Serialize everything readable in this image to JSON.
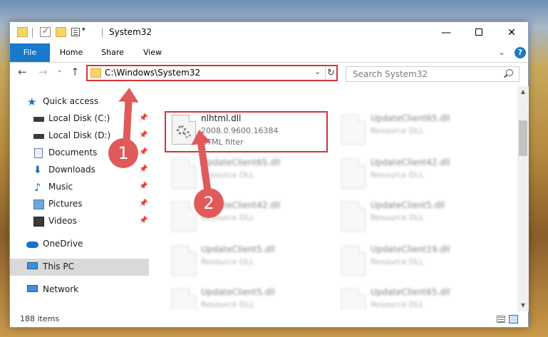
{
  "window": {
    "title": "System32"
  },
  "titlebar": {
    "minimize": "—",
    "close": "✕"
  },
  "ribbon": {
    "tabs": [
      {
        "label": "File"
      },
      {
        "label": "Home"
      },
      {
        "label": "Share"
      },
      {
        "label": "View"
      }
    ],
    "help": "?",
    "collapse": "⌄"
  },
  "nav": {
    "back": "←",
    "forward": "→",
    "recent": "⌄",
    "up": "↑",
    "address": "C:\\Windows\\System32",
    "address_dropdown": "⌄",
    "refresh": "↻",
    "search_placeholder": "Search System32"
  },
  "sidebar": {
    "items": [
      {
        "label": "Quick access",
        "icon": "star-icon"
      },
      {
        "label": "Local Disk (C:)",
        "icon": "drive-icon",
        "pinned": true
      },
      {
        "label": "Local Disk (D:)",
        "icon": "drive-icon",
        "pinned": true
      },
      {
        "label": "Documents",
        "icon": "documents-icon",
        "pinned": true
      },
      {
        "label": "Downloads",
        "icon": "download-icon",
        "pinned": true
      },
      {
        "label": "Music",
        "icon": "music-icon",
        "pinned": true
      },
      {
        "label": "Pictures",
        "icon": "pictures-icon",
        "pinned": true
      },
      {
        "label": "Videos",
        "icon": "videos-icon",
        "pinned": true
      },
      {
        "label": "OneDrive",
        "icon": "cloud-icon"
      },
      {
        "label": "This PC",
        "icon": "computer-icon",
        "selected": true
      },
      {
        "label": "Network",
        "icon": "network-icon"
      }
    ],
    "pin_glyph": "📌"
  },
  "files": [
    {
      "name": "nlhtml.dll",
      "version": "2008.0.9600.16384",
      "desc": "HTML filter",
      "highlighted": true
    },
    {
      "name": "UpdateClient65.dll",
      "desc": "Resource DLL"
    },
    {
      "name": "UpdateClient65.dll",
      "desc": "Resource DLL"
    },
    {
      "name": "UpdateClient42.dll",
      "desc": "Resource DLL"
    },
    {
      "name": "UpdateClient42.dll",
      "desc": "Resource DLL"
    },
    {
      "name": "UpdateClient5.dll",
      "desc": "Resource DLL"
    },
    {
      "name": "UpdateClient5.dll",
      "desc": "Resource DLL"
    },
    {
      "name": "UpdateClient19.dll",
      "desc": "Resource DLL"
    },
    {
      "name": "UpdateClient5.dll",
      "desc": "Resource DLL"
    },
    {
      "name": "UpdateClient65.dll",
      "desc": "Resource DLL"
    }
  ],
  "status": {
    "item_count": "188 items"
  },
  "annotations": {
    "step1": "1",
    "step2": "2",
    "color": "#e05a5a"
  },
  "colors": {
    "accent": "#1979ca",
    "highlight": "#d13438"
  }
}
